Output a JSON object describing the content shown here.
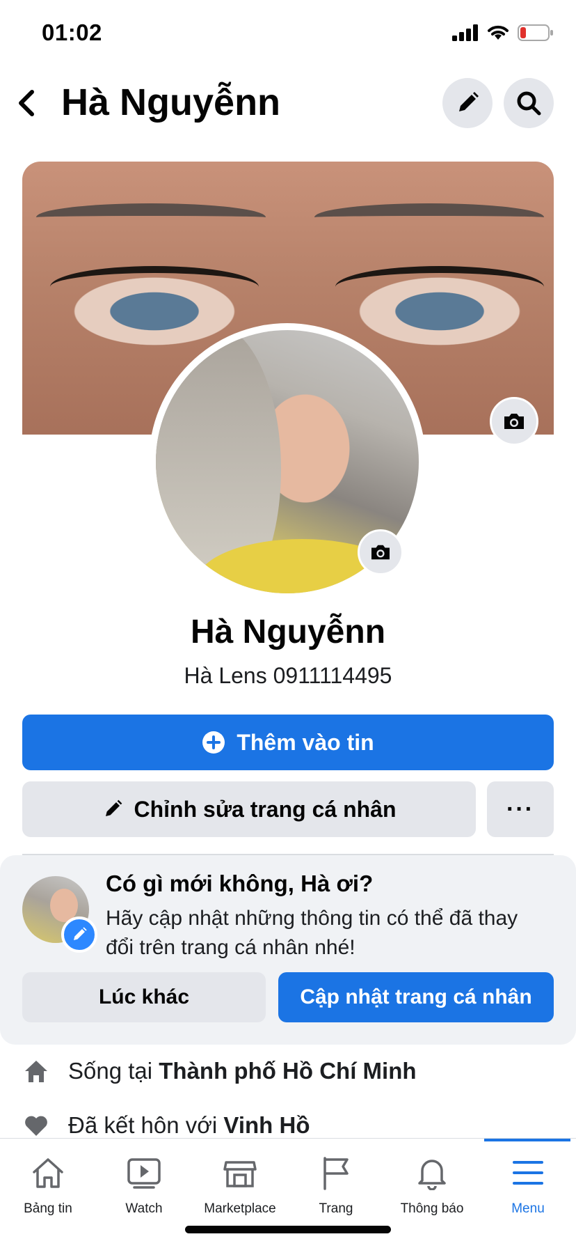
{
  "status_bar": {
    "time": "01:02"
  },
  "topbar": {
    "title": "Hà Nguyễnn"
  },
  "profile": {
    "name": "Hà Nguyễnn",
    "subtitle": "Hà Lens 0911114495"
  },
  "actions": {
    "add_story": "Thêm vào tin",
    "edit_profile": "Chỉnh sửa trang cá nhân",
    "more": "···"
  },
  "prompt": {
    "title": "Có gì mới không, Hà ơi?",
    "text": "Hãy cập nhật những thông tin có thể đã thay đổi trên trang cá nhân nhé!",
    "later": "Lúc khác",
    "update": "Cập nhật trang cá nhân"
  },
  "info": [
    {
      "prefix": "Sống tại ",
      "value": "Thành phố Hồ Chí Minh"
    },
    {
      "prefix": "Đã kết hôn với ",
      "value": "Vinh Hồ"
    }
  ],
  "bottom_nav": [
    {
      "label": "Bảng tin",
      "icon": "home-icon"
    },
    {
      "label": "Watch",
      "icon": "watch-icon"
    },
    {
      "label": "Marketplace",
      "icon": "marketplace-icon"
    },
    {
      "label": "Trang",
      "icon": "flag-icon"
    },
    {
      "label": "Thông báo",
      "icon": "bell-icon"
    },
    {
      "label": "Menu",
      "icon": "menu-icon",
      "active": true
    }
  ],
  "colors": {
    "primary": "#1b74e4",
    "button_gray": "#e4e6eb",
    "card_bg": "#f0f2f5",
    "battery_low": "#e0312c"
  }
}
